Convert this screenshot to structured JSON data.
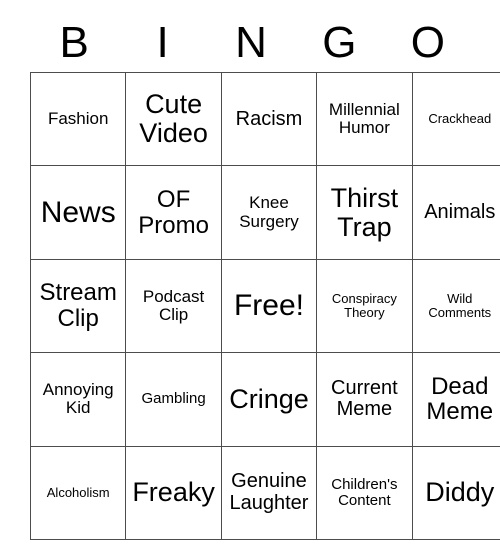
{
  "header": {
    "letters": [
      "B",
      "I",
      "N",
      "G",
      "O"
    ]
  },
  "grid": {
    "rows": [
      [
        {
          "label": "Fashion",
          "size": "md"
        },
        {
          "label": "Cute Video",
          "size": "xxl"
        },
        {
          "label": "Racism",
          "size": "lg"
        },
        {
          "label": "Millennial Humor",
          "size": "md"
        },
        {
          "label": "Crackhead",
          "size": "xs"
        }
      ],
      [
        {
          "label": "News",
          "size": "huge"
        },
        {
          "label": "OF Promo",
          "size": "xl"
        },
        {
          "label": "Knee Surgery",
          "size": "md"
        },
        {
          "label": "Thirst Trap",
          "size": "xxl"
        },
        {
          "label": "Animals",
          "size": "lg"
        }
      ],
      [
        {
          "label": "Stream Clip",
          "size": "xl"
        },
        {
          "label": "Podcast Clip",
          "size": "md"
        },
        {
          "label": "Free!",
          "size": "huge"
        },
        {
          "label": "Conspiracy Theory",
          "size": "xs"
        },
        {
          "label": "Wild Comments",
          "size": "xs"
        }
      ],
      [
        {
          "label": "Annoying Kid",
          "size": "md"
        },
        {
          "label": "Gambling",
          "size": "sm"
        },
        {
          "label": "Cringe",
          "size": "xxl"
        },
        {
          "label": "Current Meme",
          "size": "lg"
        },
        {
          "label": "Dead Meme",
          "size": "xl"
        }
      ],
      [
        {
          "label": "Alcoholism",
          "size": "xs"
        },
        {
          "label": "Freaky",
          "size": "xxl"
        },
        {
          "label": "Genuine Laughter",
          "size": "lg"
        },
        {
          "label": "Children's Content",
          "size": "sm"
        },
        {
          "label": "Diddy",
          "size": "xxl"
        }
      ]
    ]
  },
  "style": {
    "border_color": "#4d4d4d",
    "text_color": "#000000",
    "background": "#ffffff"
  }
}
